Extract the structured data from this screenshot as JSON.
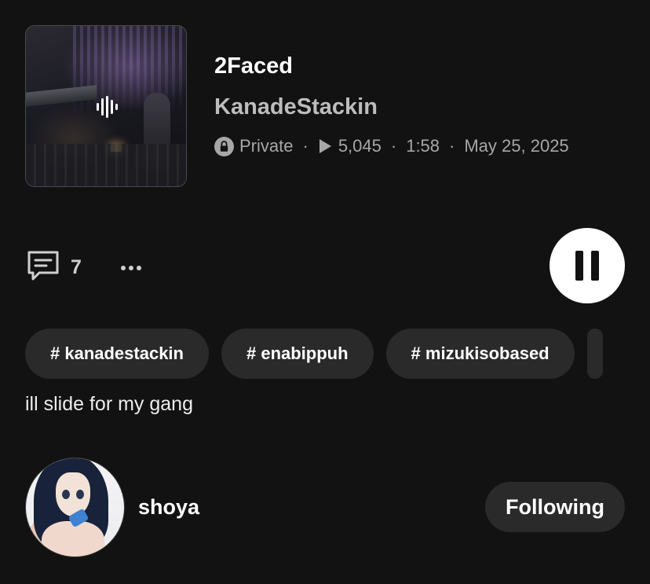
{
  "track": {
    "title": "2Faced",
    "artist": "KanadeStackin",
    "artwork_icon": "sound-wave-icon"
  },
  "meta": {
    "visibility": "Private",
    "visibility_icon": "lock-icon",
    "plays": "5,045",
    "plays_icon": "play-icon",
    "duration": "1:58",
    "date": "May 25, 2025",
    "separator": "·"
  },
  "actions": {
    "comment_icon": "comment-icon",
    "comment_count": "7",
    "more_icon": "more-horizontal-icon",
    "pause_icon": "pause-icon"
  },
  "tags": [
    {
      "label": "# kanadestackin"
    },
    {
      "label": "# enabippuh"
    },
    {
      "label": "# mizukisobased"
    }
  ],
  "description": "ill slide for my gang",
  "uploader": {
    "username": "shoya",
    "follow_label": "Following"
  },
  "colors": {
    "background": "#121212",
    "chip": "#2a2a2a",
    "secondary_text": "#a7a7a7"
  }
}
